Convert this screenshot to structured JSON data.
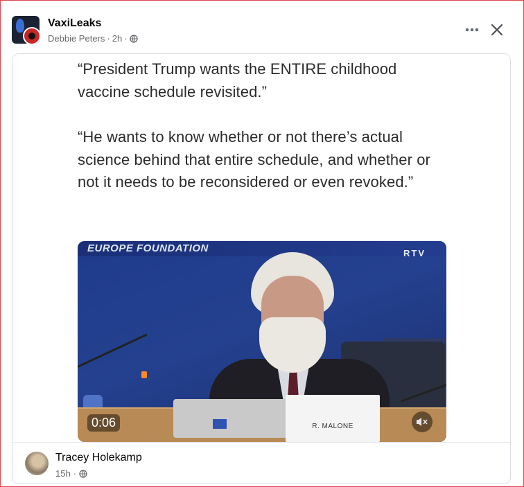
{
  "header": {
    "page_name": "VaxiLeaks",
    "poster": "Debbie Peters",
    "time": "2h",
    "separator": "·",
    "audience_icon": "globe-icon",
    "more_icon": "more-options-icon",
    "close_icon": "close-icon"
  },
  "post": {
    "quote_1": "“President Trump wants the ENTIRE childhood vaccine schedule revisited.”",
    "quote_2": "“He wants to know whether or not there’s actual science behind that entire schedule, and whether or not it needs to be reconsidered or even revoked.”",
    "video": {
      "banner_text": "EUROPE FOUNDATION",
      "channel_logo": "RTV",
      "nameplate": "R. MALONE",
      "duration": "0:06",
      "mute_icon": "muted-speaker-icon"
    }
  },
  "author": {
    "name": "Tracey Holekamp",
    "time": "15h",
    "separator": "·",
    "audience_icon": "globe-icon"
  },
  "colors": {
    "frame_border": "#e0454b",
    "text_primary": "#050505",
    "text_secondary": "#65676b"
  }
}
